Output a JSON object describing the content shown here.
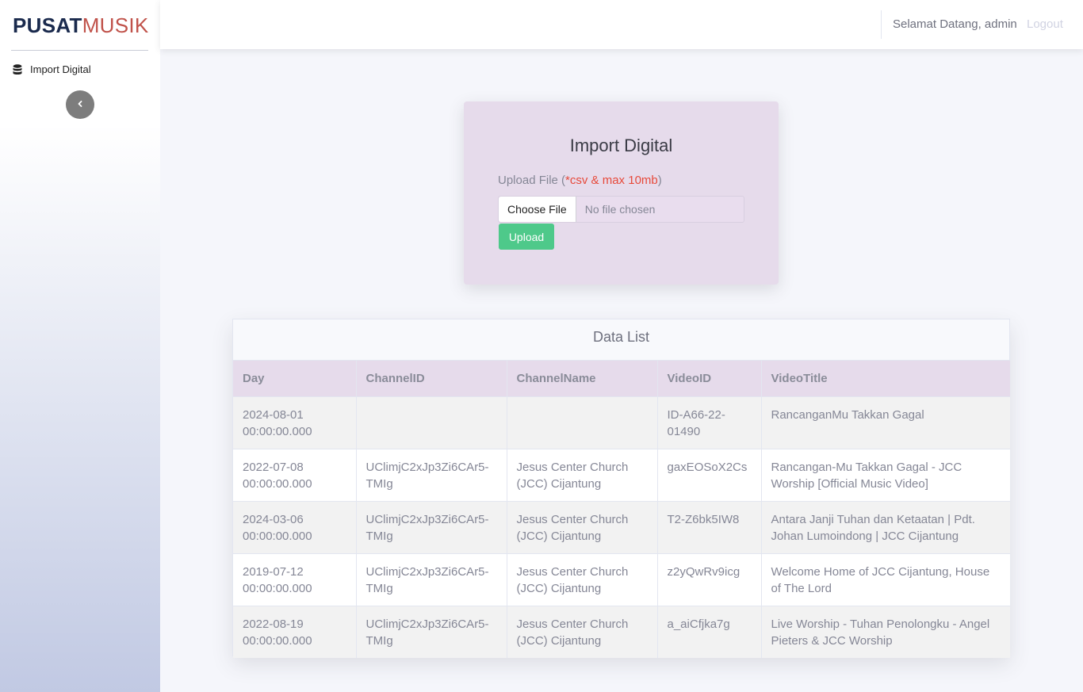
{
  "brand": {
    "part1": "PUSAT",
    "part2": "MUSIK"
  },
  "sidebar": {
    "items": [
      {
        "label": "Import Digital",
        "icon": "database-icon"
      }
    ]
  },
  "topbar": {
    "welcome": "Selamat Datang, admin",
    "logout": "Logout"
  },
  "upload": {
    "title": "Import Digital",
    "label": "Upload File",
    "label_open": " (",
    "requirement": "*csv & max 10mb",
    "label_close": ")",
    "file_button": "Choose File",
    "file_status": "No file chosen",
    "submit": "Upload"
  },
  "data_list": {
    "title": "Data List",
    "columns": [
      "Day",
      "ChannelID",
      "ChannelName",
      "VideoID",
      "VideoTitle"
    ],
    "rows": [
      [
        "2024-08-01 00:00:00.000",
        "",
        "",
        "ID-A66-22-01490",
        "RancanganMu Takkan Gagal"
      ],
      [
        "2022-07-08 00:00:00.000",
        "UClimjC2xJp3Zi6CAr5-TMIg",
        "Jesus Center Church (JCC) Cijantung",
        "gaxEOSoX2Cs",
        "Rancangan-Mu Takkan Gagal - JCC Worship [Official Music Video]"
      ],
      [
        "2024-03-06 00:00:00.000",
        "UClimjC2xJp3Zi6CAr5-TMIg",
        "Jesus Center Church (JCC) Cijantung",
        "T2-Z6bk5IW8",
        "Antara Janji Tuhan dan Ketaatan | Pdt. Johan Lumoindong | JCC Cijantung"
      ],
      [
        "2019-07-12 00:00:00.000",
        "UClimjC2xJp3Zi6CAr5-TMIg",
        "Jesus Center Church (JCC) Cijantung",
        "z2yQwRv9icg",
        "Welcome Home of JCC Cijantung, House of The Lord"
      ],
      [
        "2022-08-19 00:00:00.000",
        "UClimjC2xJp3Zi6CAr5-TMIg",
        "Jesus Center Church (JCC) Cijantung",
        "a_aiCfjka7g",
        "Live Worship - Tuhan Penolongku - Angel Pieters & JCC Worship"
      ]
    ]
  },
  "colors": {
    "accent": "#e6dbeb",
    "success": "#4ec98a",
    "danger": "#e74a3b",
    "brand_dark": "#1a2a4d",
    "brand_red": "#c0524a"
  }
}
